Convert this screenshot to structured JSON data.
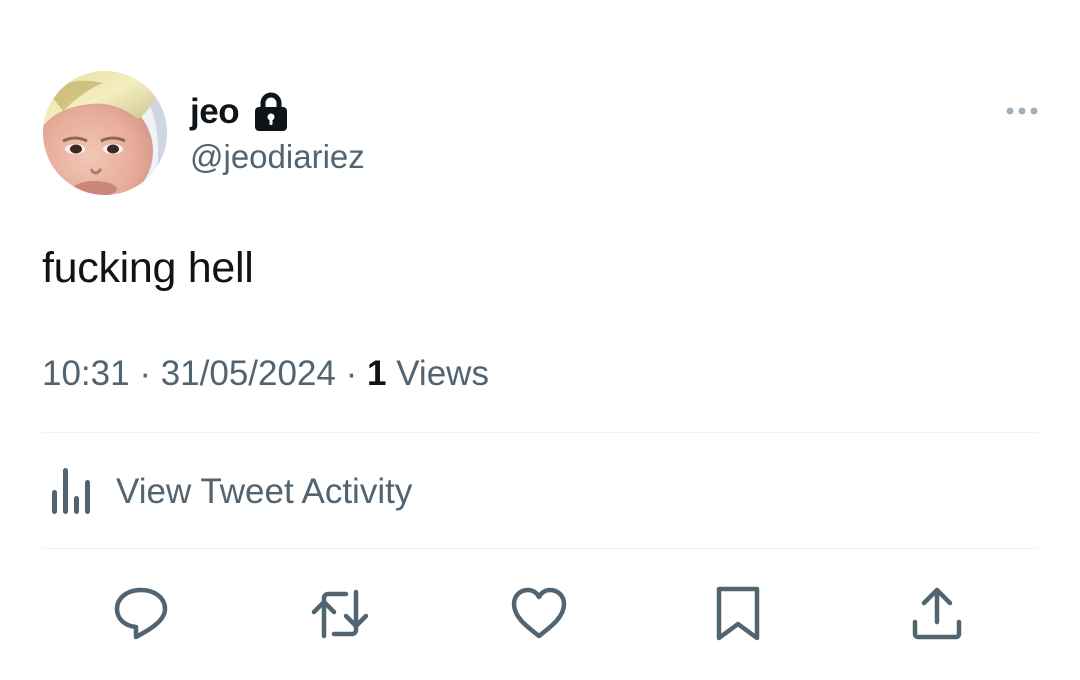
{
  "tweet": {
    "author": {
      "display_name": "jeo",
      "handle": "@jeodiariez",
      "protected_icon": "lock-icon",
      "avatar": "profile-photo"
    },
    "more_icon": "more-horizontal-icon",
    "text": "fucking hell",
    "time": "10:31",
    "separator": "·",
    "date": "31/05/2024",
    "views_count": "1",
    "views_label": "Views",
    "activity": {
      "icon": "analytics-bars-icon",
      "label": "View Tweet Activity"
    },
    "actions": [
      {
        "name": "reply",
        "icon": "reply-bubble-icon"
      },
      {
        "name": "retweet",
        "icon": "retweet-icon"
      },
      {
        "name": "like",
        "icon": "heart-icon"
      },
      {
        "name": "bookmark",
        "icon": "bookmark-icon"
      },
      {
        "name": "share",
        "icon": "share-upload-icon"
      }
    ]
  },
  "colors": {
    "text_primary": "#0f1419",
    "text_secondary": "#536471",
    "divider": "#eff3f4",
    "background": "#ffffff"
  }
}
